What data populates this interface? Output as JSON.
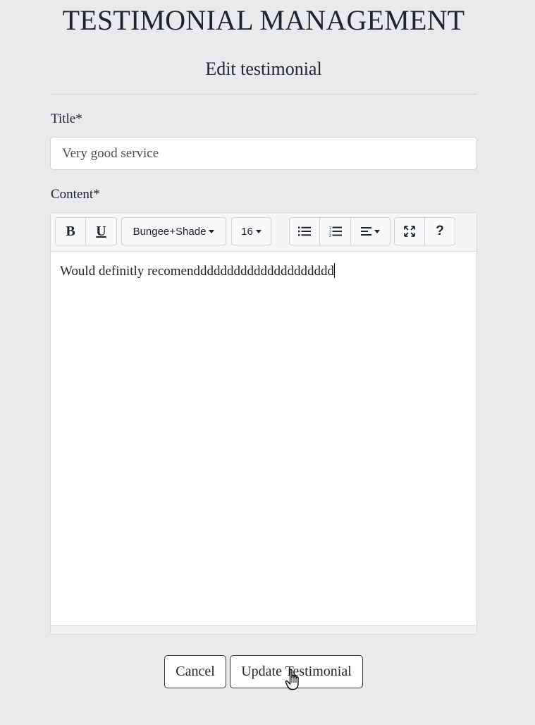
{
  "header": {
    "title": "TESTIMONIAL MANAGEMENT",
    "subtitle": "Edit testimonial"
  },
  "form": {
    "title_label": "Title*",
    "title_value": "Very good service",
    "content_label": "Content*"
  },
  "editor": {
    "toolbar": {
      "bold_label": "B",
      "underline_label": "U",
      "font_family": "Bungee+Shade",
      "font_size": "16",
      "help_label": "?",
      "icons": [
        "bold-icon",
        "underline-icon",
        "unordered-list-icon",
        "ordered-list-icon",
        "align-left-icon",
        "fullscreen-icon",
        "help-icon"
      ]
    },
    "content_text": "Would definitly recomenddddddddddddddddddddd"
  },
  "actions": {
    "cancel_label": "Cancel",
    "update_label": "Update Testimonial"
  },
  "colors": {
    "page_background": "#e9eaec",
    "toolbar_background": "#f5f5f5",
    "button_border": "#343a40"
  }
}
